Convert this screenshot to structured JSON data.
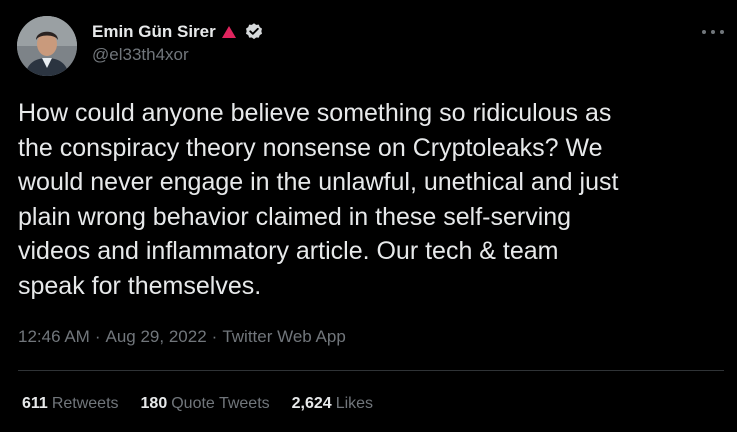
{
  "author": {
    "display_name": "Emin Gün Sirer",
    "handle": "@el33th4xor",
    "flag_color": "#e0245e",
    "badge": "verified-icon"
  },
  "tweet": {
    "text": "How could anyone believe something so ridiculous as\nthe conspiracy theory nonsense on Cryptoleaks? We\nwould never engage in the unlawful, unethical and just\nplain wrong behavior claimed in these self-serving\nvideos and inflammatory article. Our tech & team\nspeak for themselves.",
    "time": "12:46 AM",
    "date": "Aug 29, 2022",
    "source": "Twitter Web App",
    "separator": "·"
  },
  "stats": {
    "retweets": {
      "count": "611",
      "label": "Retweets"
    },
    "quotes": {
      "count": "180",
      "label": "Quote Tweets"
    },
    "likes": {
      "count": "2,624",
      "label": "Likes"
    }
  },
  "colors": {
    "background": "#000000",
    "text": "#e7e9ea",
    "secondary": "#71767b",
    "divider": "#2f3336"
  }
}
